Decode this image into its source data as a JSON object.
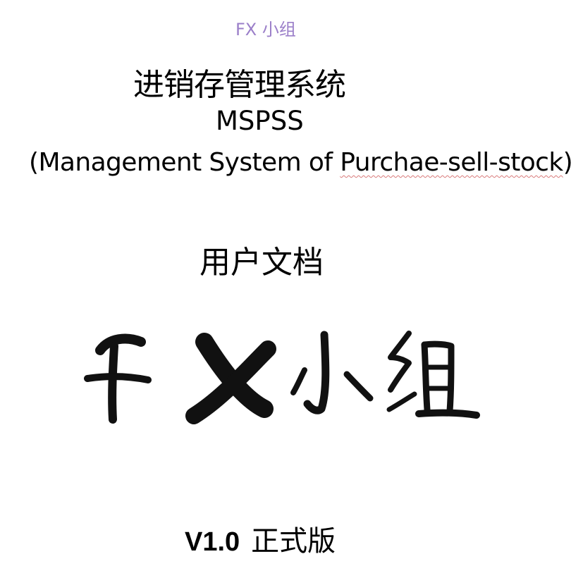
{
  "header": {
    "tag": "FX 小组"
  },
  "title": {
    "chinese": "进销存管理系统",
    "abbreviation": "MSPSS",
    "full_prefix": "(Management System of ",
    "full_flagged": "Purchae-sell-stock",
    "full_suffix": ")"
  },
  "document_type": "用户文档",
  "logo": {
    "text": "FX 小组"
  },
  "release": {
    "version": "V1.0",
    "label": "正式版"
  },
  "colors": {
    "header_tag": "#9b7fc9",
    "spellcheck_underline": "#d97a7a",
    "ink": "#000000"
  }
}
